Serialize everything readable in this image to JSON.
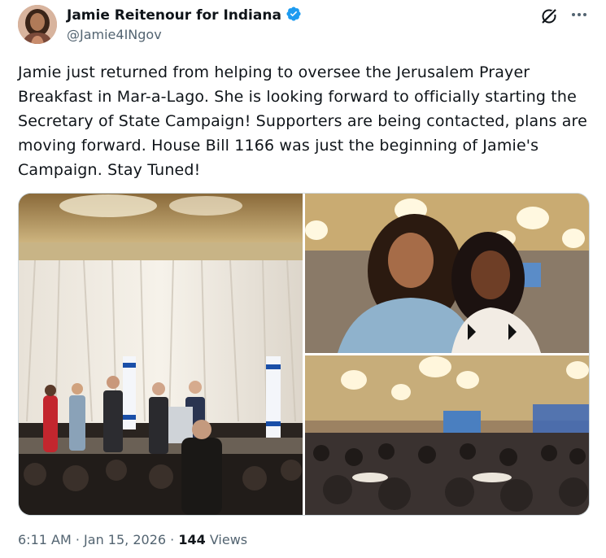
{
  "author": {
    "name": "Jamie Reitenour for Indiana",
    "handle": "@Jamie4INgov",
    "verified": true
  },
  "tweet": {
    "text_lines": [
      "Jamie just returned from helping to oversee the Jerusalem Prayer",
      "Breakfast in Mar-a-Lago. She is looking forward to officially starting the",
      "Secretary of State Campaign! Supporters are being contacted, plans are",
      "moving forward. House Bill 1166 was just the beginning of Jamie's",
      "Campaign. Stay Tuned!"
    ],
    "time": "6:11 AM",
    "separator": "·",
    "date": "Jan 15, 2026",
    "views_count": "144",
    "views_label": "Views"
  },
  "media": [
    {
      "description_icon": "photo-stage"
    },
    {
      "description_icon": "photo-selfie"
    },
    {
      "description_icon": "photo-ballroom"
    }
  ],
  "icons": [
    "verified-badge-icon",
    "grok-icon",
    "more-icon"
  ],
  "colors": {
    "text": "#0f1419",
    "secondary": "#536471",
    "verified": "#1d9bf0",
    "border": "#cfd9de"
  }
}
